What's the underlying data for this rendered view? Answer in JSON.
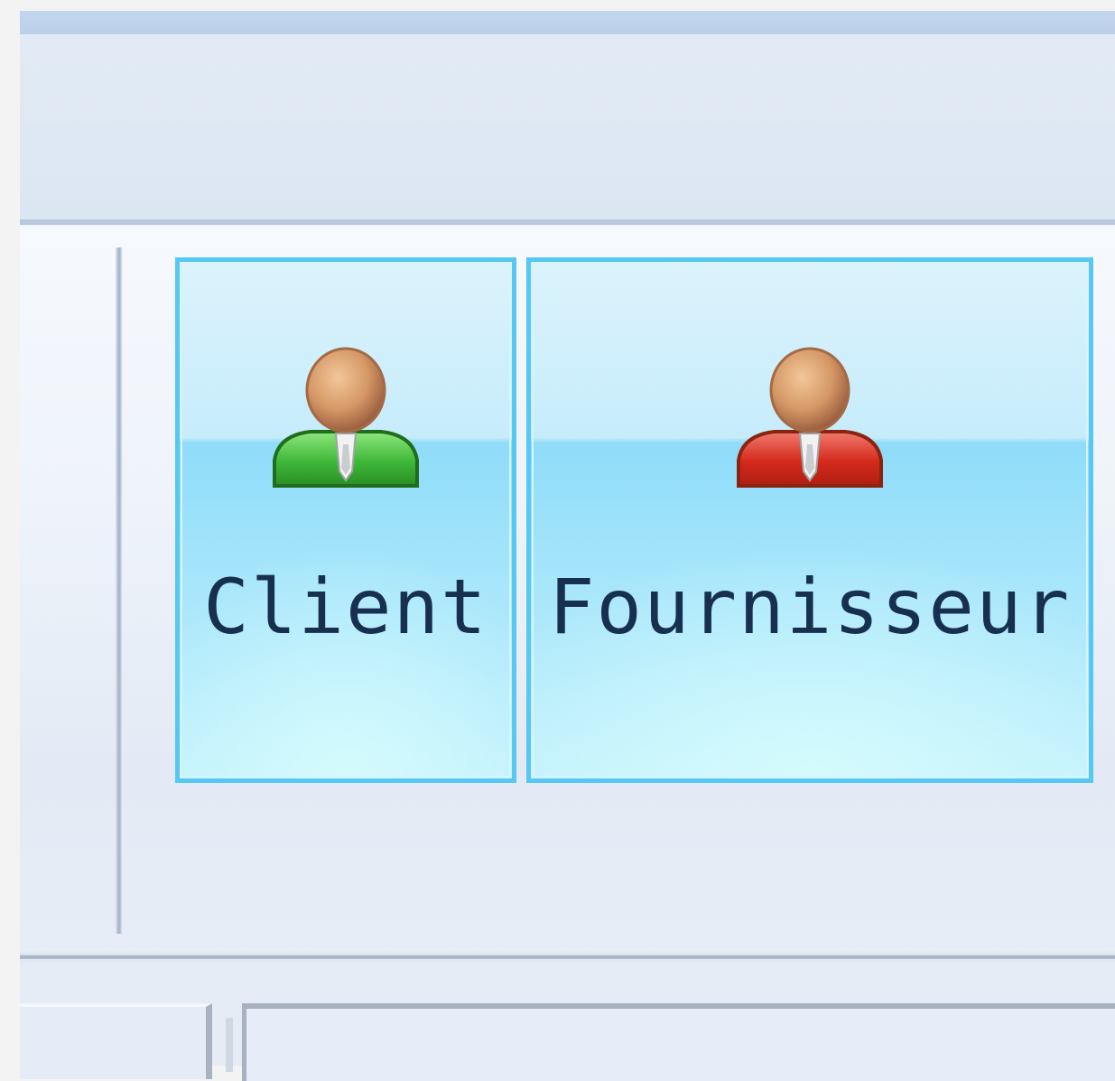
{
  "ribbon": {
    "buttons": [
      {
        "label": "Client",
        "icon": "user-green-icon",
        "color": "#3fb83a"
      },
      {
        "label": "Fournisseur",
        "icon": "user-red-icon",
        "color": "#d42a1c"
      }
    ]
  },
  "colors": {
    "button_border": "#56c8f2",
    "label_text": "#17304f"
  }
}
